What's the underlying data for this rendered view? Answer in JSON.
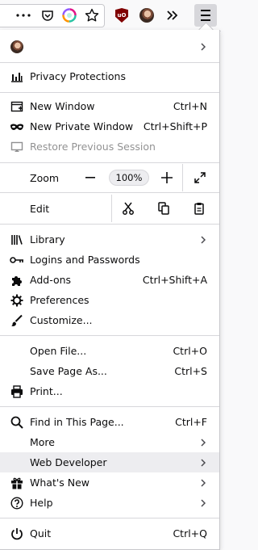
{
  "toolbar": {
    "icons": [
      "overflow-dots-icon",
      "pocket-icon",
      "sync-colorful-icon",
      "bookmark-star-icon",
      "ublock-origin-icon",
      "account-avatar-icon",
      "extensions-overflow-icon",
      "hamburger-menu-icon"
    ],
    "ublock_label": "uO"
  },
  "menu": {
    "account_chevron": "›",
    "privacy_protections": "Privacy Protections",
    "new_window": "New Window",
    "new_window_shortcut": "Ctrl+N",
    "new_private_window": "New Private Window",
    "new_private_window_shortcut": "Ctrl+Shift+P",
    "restore_session": "Restore Previous Session",
    "zoom_label": "Zoom",
    "zoom_minus": "—",
    "zoom_value": "100%",
    "zoom_plus": "+",
    "edit_label": "Edit",
    "library": "Library",
    "logins": "Logins and Passwords",
    "addons": "Add-ons",
    "addons_shortcut": "Ctrl+Shift+A",
    "preferences": "Preferences",
    "customize": "Customize...",
    "open_file": "Open File...",
    "open_file_shortcut": "Ctrl+O",
    "save_page": "Save Page As...",
    "save_page_shortcut": "Ctrl+S",
    "print": "Print...",
    "find": "Find in This Page...",
    "find_shortcut": "Ctrl+F",
    "more": "More",
    "web_developer": "Web Developer",
    "whats_new": "What's New",
    "help": "Help",
    "quit": "Quit",
    "quit_shortcut": "Ctrl+Q"
  },
  "colors": {
    "toolbar_bg": "#f9f9fa",
    "panel_bg": "#ffffff",
    "hover_bg": "#ededf0",
    "separator": "#d7d7db",
    "ublock": "#800000"
  }
}
